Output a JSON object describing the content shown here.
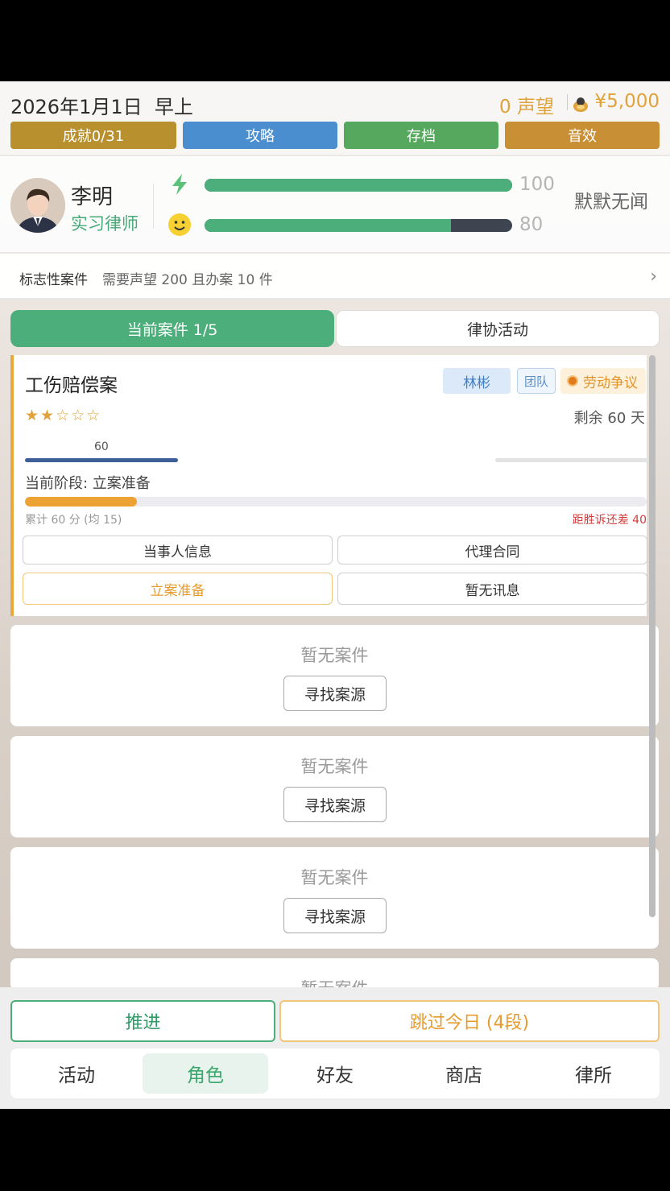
{
  "header": {
    "date": "2026年1月1日",
    "time_of_day": "早上",
    "reputation": "0 声望",
    "money": "¥5,000",
    "buttons": {
      "achievements": "成就0/31",
      "guide": "攻略",
      "save": "存档",
      "sound": "音效"
    }
  },
  "profile": {
    "name": "李明",
    "title": "实习律师",
    "energy": {
      "value": "100",
      "fraction": 1.0
    },
    "mood": {
      "value": "80",
      "fraction": 0.8
    },
    "fame_status": "默默无闻"
  },
  "milestone": {
    "title": "标志性案件",
    "requirement": "需要声望 200 且办案 10 件",
    "arrow": "›"
  },
  "tabs": {
    "current": "当前案件 1/5",
    "association": "律协活动"
  },
  "case": {
    "title": "工伤赔偿案",
    "lawyer_tag": "林彬",
    "team_tag": "团队",
    "type_tag": "劳动争议",
    "stars": "★★☆☆☆",
    "remaining": "剩余 60 天",
    "progress_value": "60",
    "stage": "当前阶段: 立案准备",
    "stage_fraction": 0.18,
    "score": "累计 60 分 (均 15)",
    "gap": "距胜诉还差 40",
    "buttons": {
      "client_info": "当事人信息",
      "contract": "代理合同",
      "filing": "立案准备",
      "no_message": "暂无讯息"
    }
  },
  "empty_slots": {
    "empty_label": "暂无案件",
    "find_label": "寻找案源"
  },
  "bottom": {
    "advance": "推进",
    "skip": "跳过今日 (4段)",
    "nav": [
      "活动",
      "角色",
      "好友",
      "商店",
      "律所"
    ]
  },
  "colors": {
    "accent_green": "#4cae7a",
    "accent_orange": "#e9a93a",
    "warning_red": "#d33c3c"
  }
}
